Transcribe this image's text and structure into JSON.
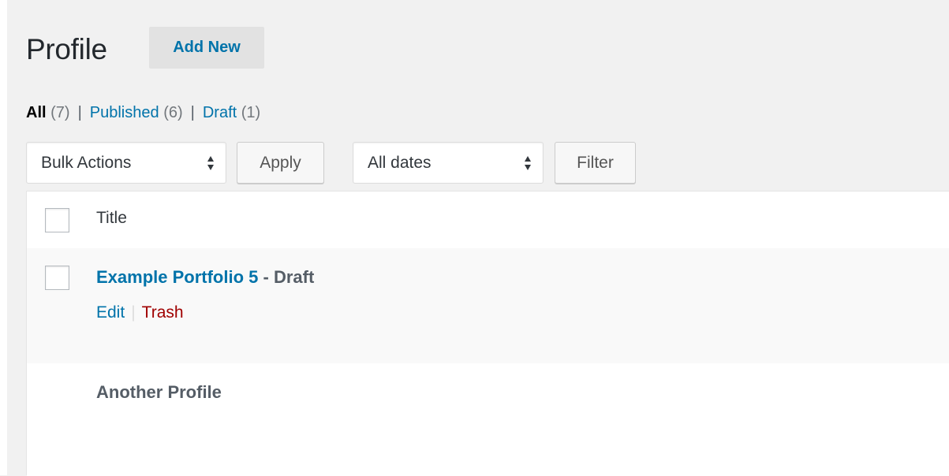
{
  "header": {
    "title": "Profile",
    "add_new_label": "Add New"
  },
  "views": {
    "all_label": "All",
    "all_count": "(7)",
    "published_label": "Published",
    "published_count": "(6)",
    "draft_label": "Draft",
    "draft_count": "(1)",
    "separator": "|"
  },
  "toolbar": {
    "bulk_actions_value": "Bulk Actions",
    "apply_label": "Apply",
    "dates_value": "All dates",
    "filter_label": "Filter"
  },
  "table": {
    "column_title": "Title",
    "rows": [
      {
        "title": "Example Portfolio 5",
        "state": " - Draft",
        "edit_label": "Edit",
        "action_separator": "|",
        "trash_label": "Trash"
      },
      {
        "title": "Another Profile"
      }
    ]
  },
  "colors": {
    "link": "#0073aa",
    "trash": "#a00000",
    "background": "#f1f1f1"
  },
  "icons": {
    "select_arrows": "sort-arrows-icon"
  }
}
